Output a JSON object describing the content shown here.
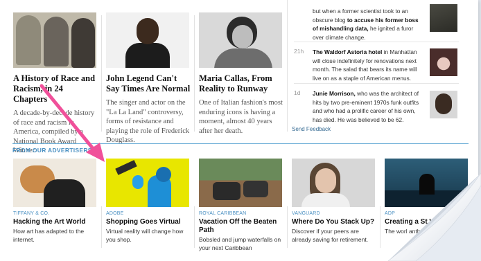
{
  "stories": [
    {
      "title": "A History of Race and Racism, in 24 Chapters",
      "desc": "A decade-by-decade history of race and racism in America, compiled by a National Book Award Winner."
    },
    {
      "title": "John Legend Can't Say Times Are Normal",
      "desc": "The singer and actor on the \"La La Land\" controversy, forms of resistance and playing the role of Frederick Douglass."
    },
    {
      "title": "Maria Callas, From Reality to Runway",
      "desc": "One of Italian fashion's most enduring icons is having a moment, almost 40 years after her death."
    }
  ],
  "news": [
    {
      "age": "",
      "pre": "but when a former scientist took to an obscure blog ",
      "bold": "to accuse his former boss of mishandling data,",
      "post": " he ignited a furor over climate change."
    },
    {
      "age": "21h",
      "pre": "",
      "bold": "The Waldorf Astoria hotel",
      "post": " in Manhattan will close indefinitely for renovations next month. The salad that bears its name will live on as a staple of American menus."
    },
    {
      "age": "1d",
      "pre": "",
      "bold": "Junie Morrison,",
      "post": " who was the architect of hits by two pre-eminent 1970s funk outfits and who had a prolific career of his own, has died. He was believed to be 62."
    }
  ],
  "feedback": "Send Feedback",
  "advertisers": {
    "heading": "FROM OUR ADVERTISERS",
    "ads": [
      {
        "sponsor": "TIFFANY & CO.",
        "title": "Hacking the Art World",
        "desc": "How art has adapted to the internet."
      },
      {
        "sponsor": "ADOBE",
        "title": "Shopping Goes Virtual",
        "desc": "Virtual reality will change how you shop."
      },
      {
        "sponsor": "ROYAL CARIBBEAN",
        "title": "Vacation Off the Beaten Path",
        "desc": "Bobsled and jump waterfalls on your next Caribbean"
      },
      {
        "sponsor": "VANGUARD",
        "title": "Where Do You Stack Up?",
        "desc": "Discover if your peers are already saving for retirement."
      },
      {
        "sponsor": "ADP",
        "title": "Creating a St Workforce",
        "desc": "The worl anthe"
      }
    ]
  },
  "colors": {
    "arrow": "#f0509a",
    "accent": "#4a90c2",
    "link": "#326891"
  }
}
